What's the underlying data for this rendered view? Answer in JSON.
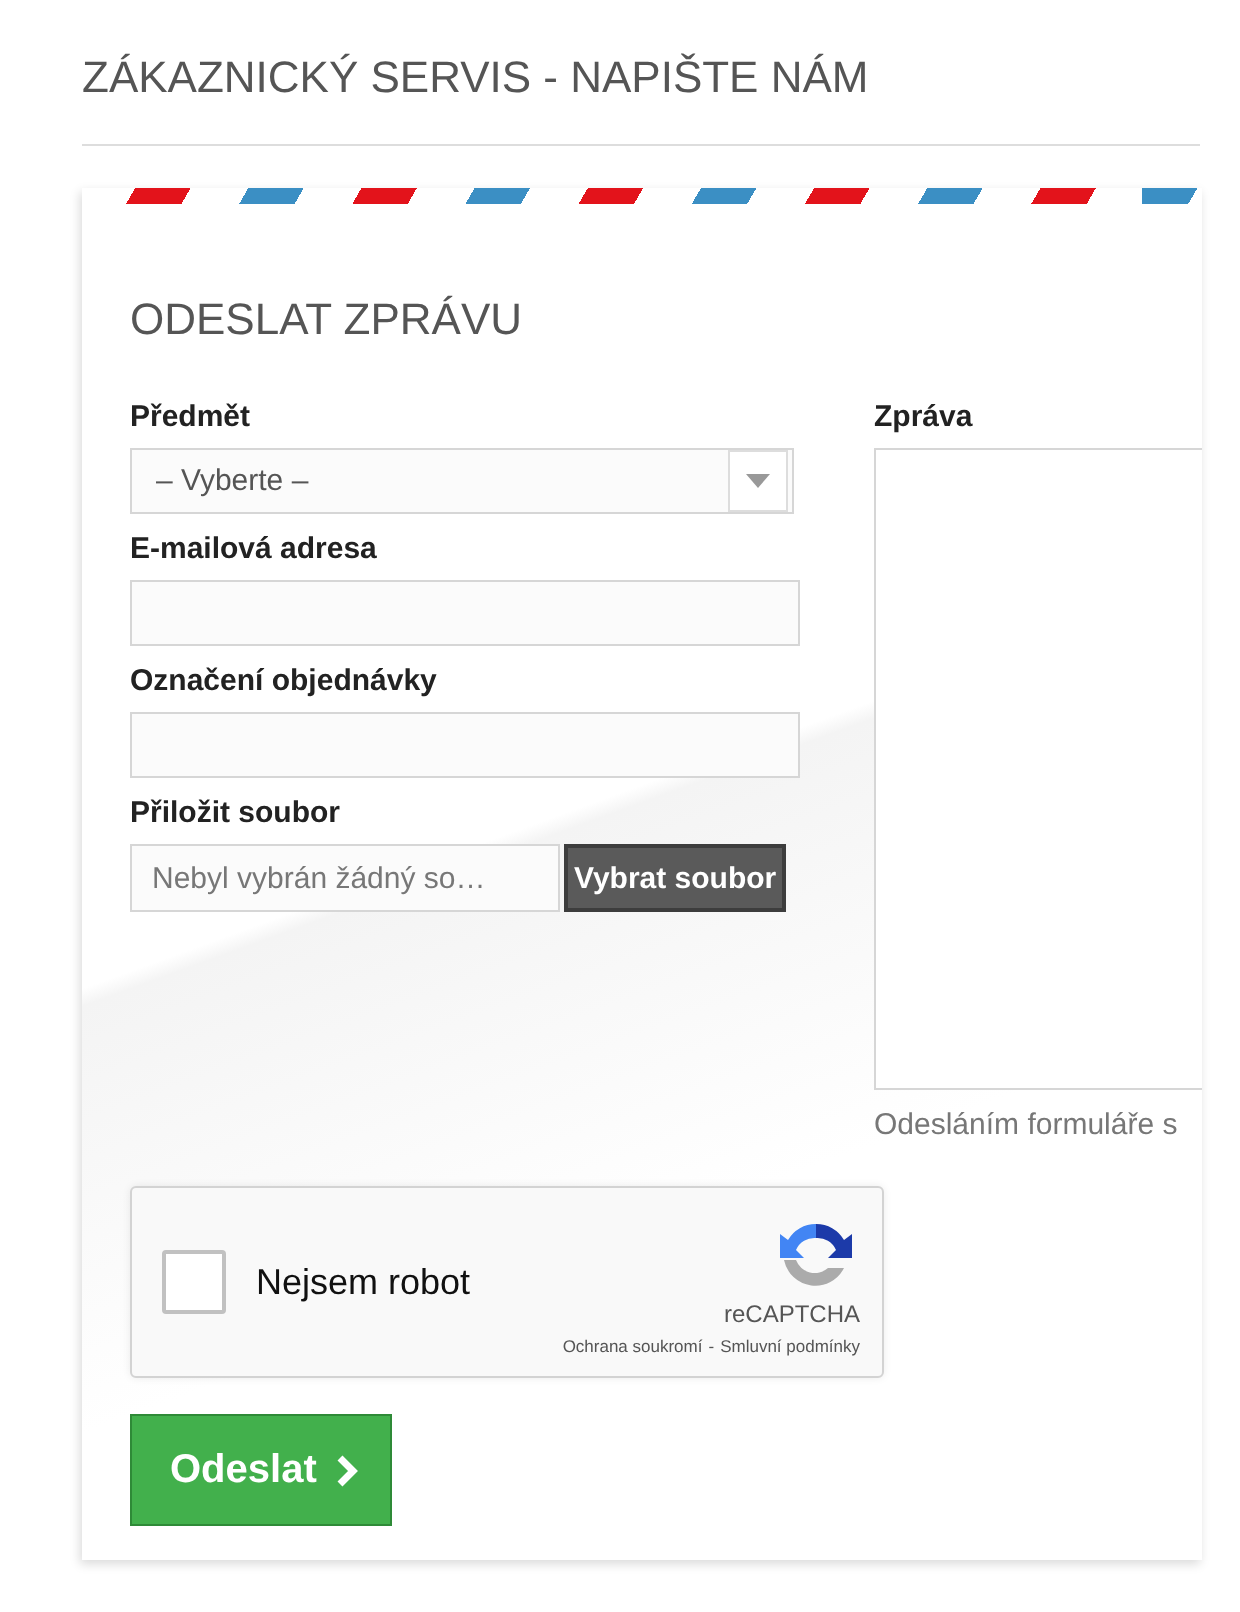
{
  "page_title": "ZÁKAZNICKÝ SERVIS - NAPIŠTE NÁM",
  "form": {
    "heading": "ODESLAT ZPRÁVU",
    "fields": [
      {
        "kind": "select",
        "label": "Předmět",
        "value": "– Vyberte –"
      },
      {
        "kind": "text",
        "label": "E-mailová adresa"
      },
      {
        "kind": "text",
        "label": "Označení objednávky"
      },
      {
        "kind": "file",
        "label": "Přiložit soubor",
        "placeholder": "Nebyl vybrán žádný so…",
        "button": "Vybrat soubor"
      }
    ],
    "message": {
      "label": "Zpráva",
      "note": "Odesláním formuláře s"
    },
    "captcha": {
      "checked": false,
      "label": "Nejsem robot",
      "brand": "reCAPTCHA",
      "links": [
        "Ochrana soukromí",
        "Smluvní podmínky"
      ],
      "separator": "-"
    },
    "submit": "Odeslat"
  }
}
